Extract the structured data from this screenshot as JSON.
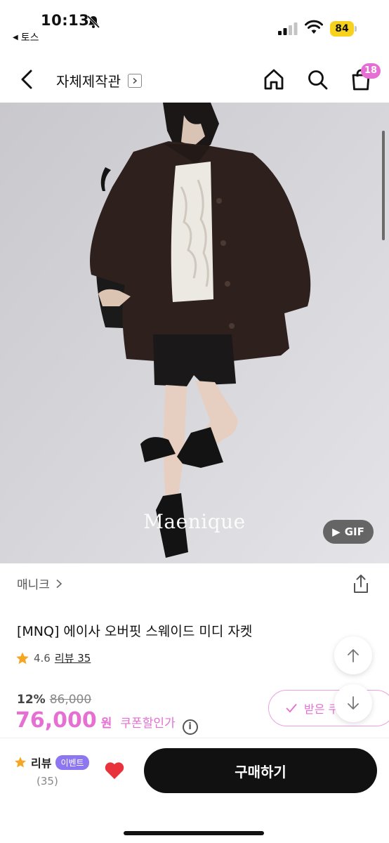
{
  "status": {
    "time": "10:13",
    "back_app": "토스",
    "battery": "84"
  },
  "nav": {
    "title": "자체제작관",
    "cart_count": "18"
  },
  "image": {
    "watermark": "Maenique",
    "gif_label": "GIF"
  },
  "product": {
    "brand": "매니크",
    "title": "[MNQ] 에이사 오버핏 스웨이드 미디 자켓",
    "rating": "4.6",
    "review_link": "리뷰 35",
    "discount_pct": "12%",
    "original_price": "86,000",
    "price": "76,000",
    "currency": "원",
    "coupon_text": "쿠폰할인가",
    "coupon_button": "받은 쿠"
  },
  "bottom": {
    "review_label": "리뷰",
    "event_badge": "이벤트",
    "review_count": "(35)",
    "buy_label": "구매하기"
  },
  "colors": {
    "accent": "#e56fd3",
    "event": "#8e76f0",
    "star": "#f5a623",
    "heart": "#e8323c"
  }
}
